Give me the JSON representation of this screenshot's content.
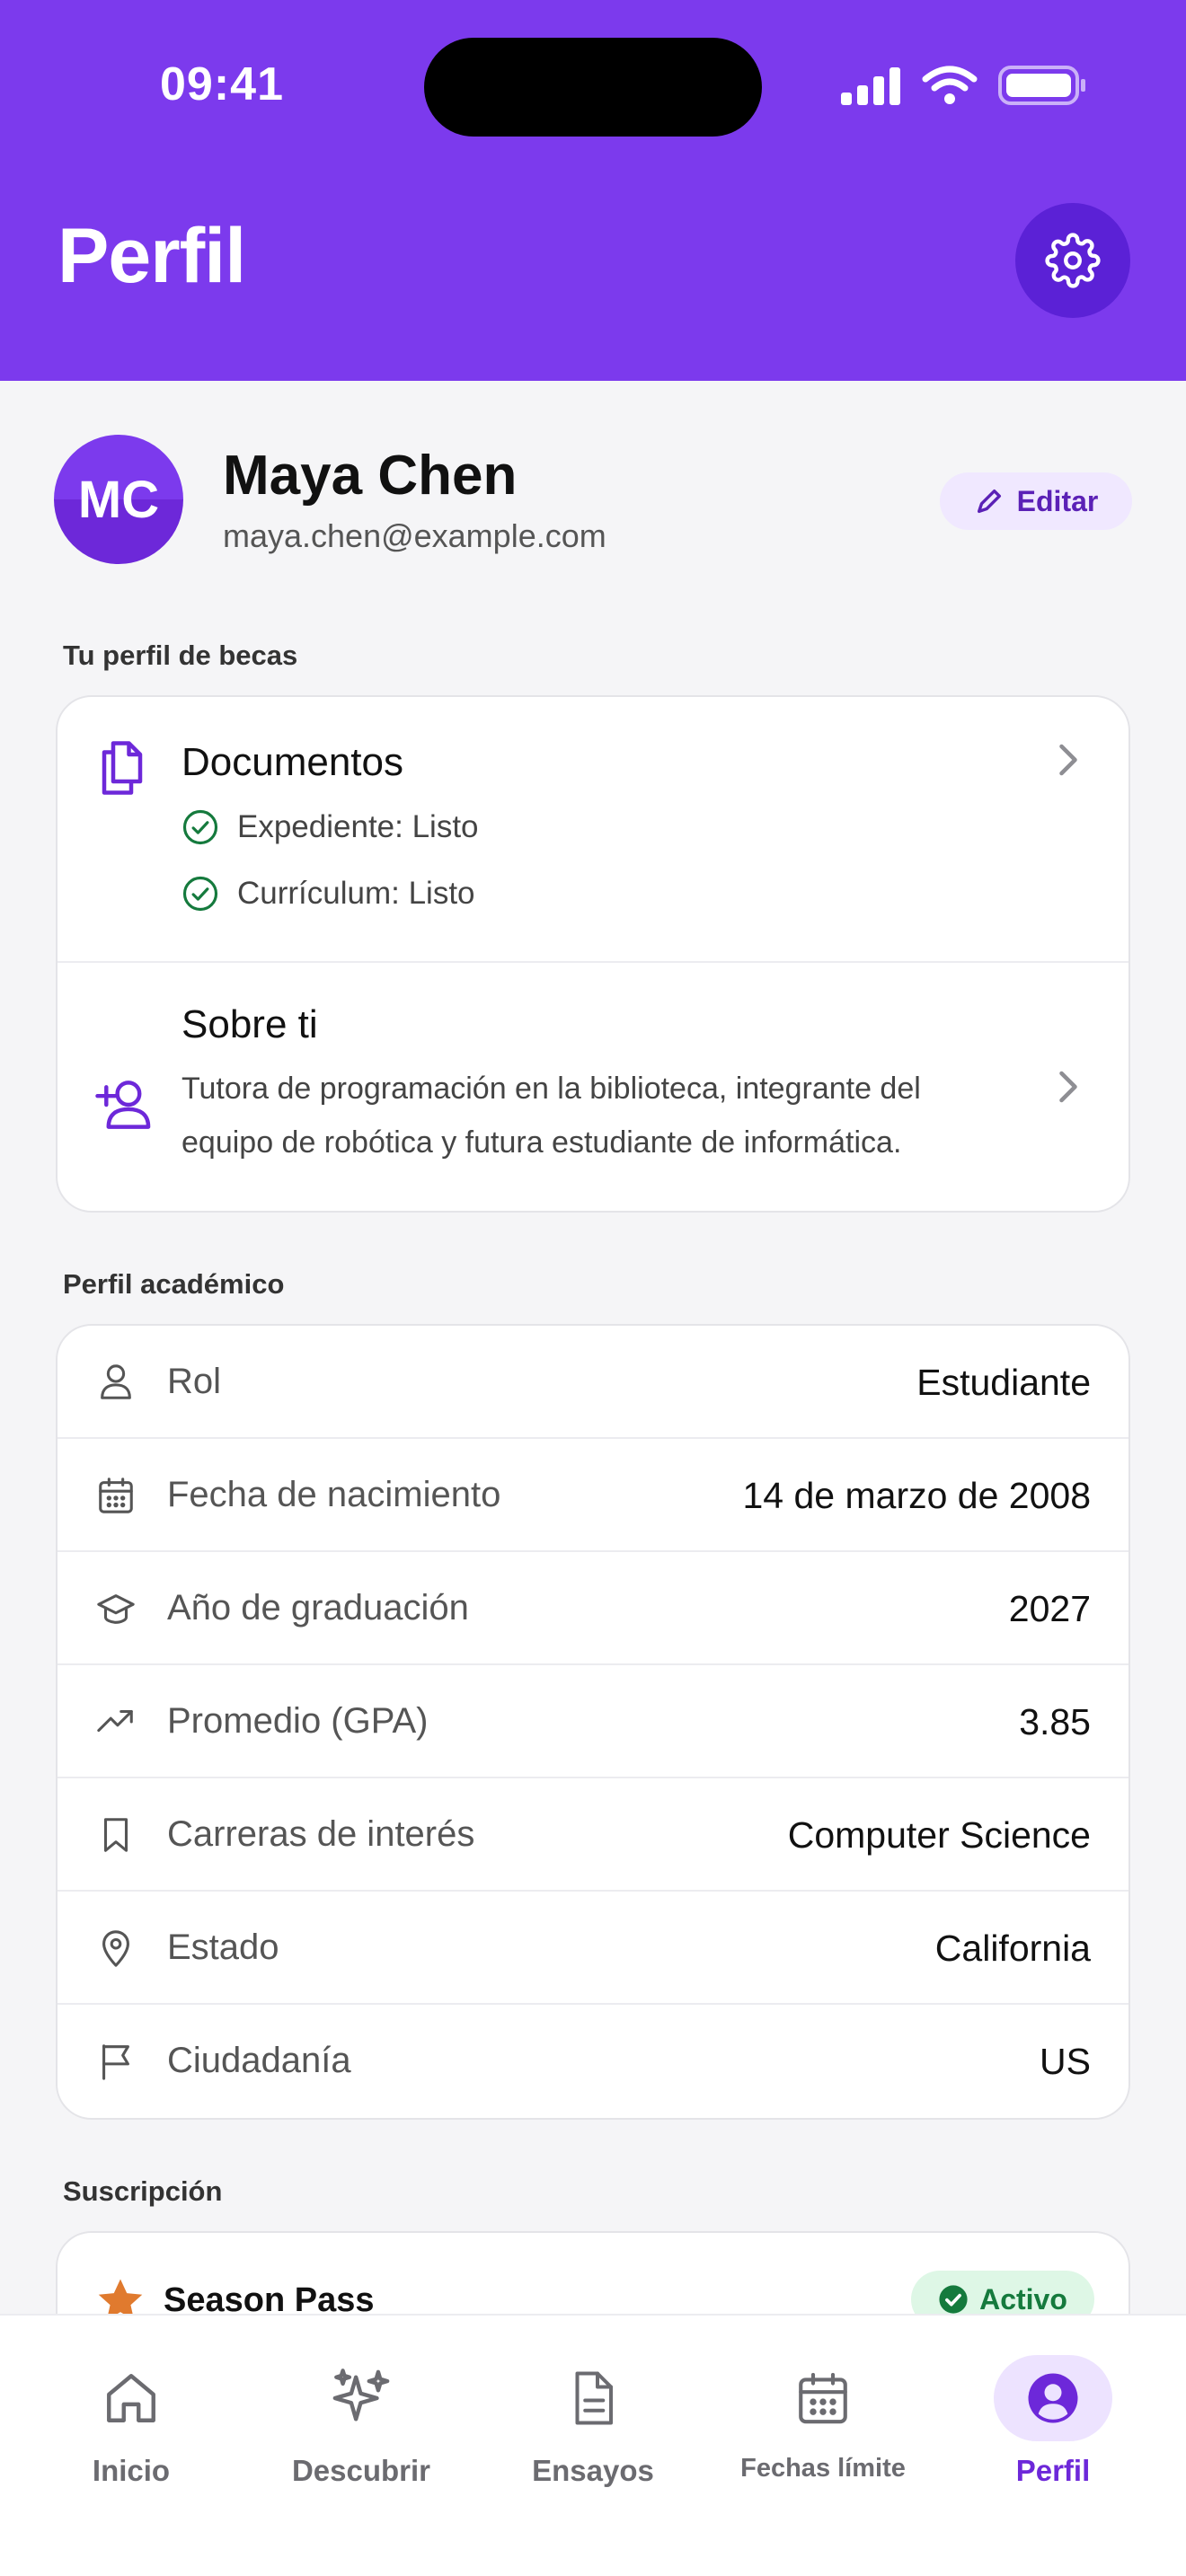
{
  "status_bar": {
    "time": "09:41"
  },
  "header": {
    "title": "Perfil",
    "settings_icon": "gear-icon",
    "background": "#7c3aed"
  },
  "profile": {
    "initials": "MC",
    "name": "Maya Chen",
    "email": "maya.chen@example.com",
    "edit_label": "Editar"
  },
  "scholarship_profile": {
    "section_title": "Tu perfil de becas",
    "documents": {
      "title": "Documentos",
      "items": [
        "Expediente: Listo",
        "Currículum: Listo"
      ]
    },
    "about": {
      "title": "Sobre ti",
      "text": "Tutora de programación en la biblioteca, integrante del equipo de robótica y futura estudiante de informática."
    }
  },
  "academic": {
    "section_title": "Perfil académico",
    "rows": [
      {
        "icon": "user-icon",
        "label": "Rol",
        "value": "Estudiante"
      },
      {
        "icon": "calendar-icon",
        "label": "Fecha de nacimiento",
        "value": "14 de marzo de 2008"
      },
      {
        "icon": "graduation-cap-icon",
        "label": "Año de graduación",
        "value": "2027"
      },
      {
        "icon": "trending-up-icon",
        "label": "Promedio (GPA)",
        "value": "3.85"
      },
      {
        "icon": "bookmark-icon",
        "label": "Carreras de interés",
        "value": "Computer Science"
      },
      {
        "icon": "map-pin-icon",
        "label": "Estado",
        "value": "California"
      },
      {
        "icon": "flag-icon",
        "label": "Ciudadanía",
        "value": "US"
      }
    ]
  },
  "subscription": {
    "section_title": "Suscripción",
    "plan": "Season Pass",
    "status": "Activo"
  },
  "tabbar": {
    "tabs": [
      {
        "label": "Inicio",
        "icon": "home-icon"
      },
      {
        "label": "Descubrir",
        "icon": "sparkles-icon"
      },
      {
        "label": "Ensayos",
        "icon": "document-icon"
      },
      {
        "label": "Fechas límite",
        "icon": "calendar-icon"
      },
      {
        "label": "Perfil",
        "icon": "profile-icon"
      }
    ],
    "active": "Perfil"
  },
  "colors": {
    "accent": "#7c3aed",
    "success": "#157a3d",
    "star": "#e07a2e"
  }
}
